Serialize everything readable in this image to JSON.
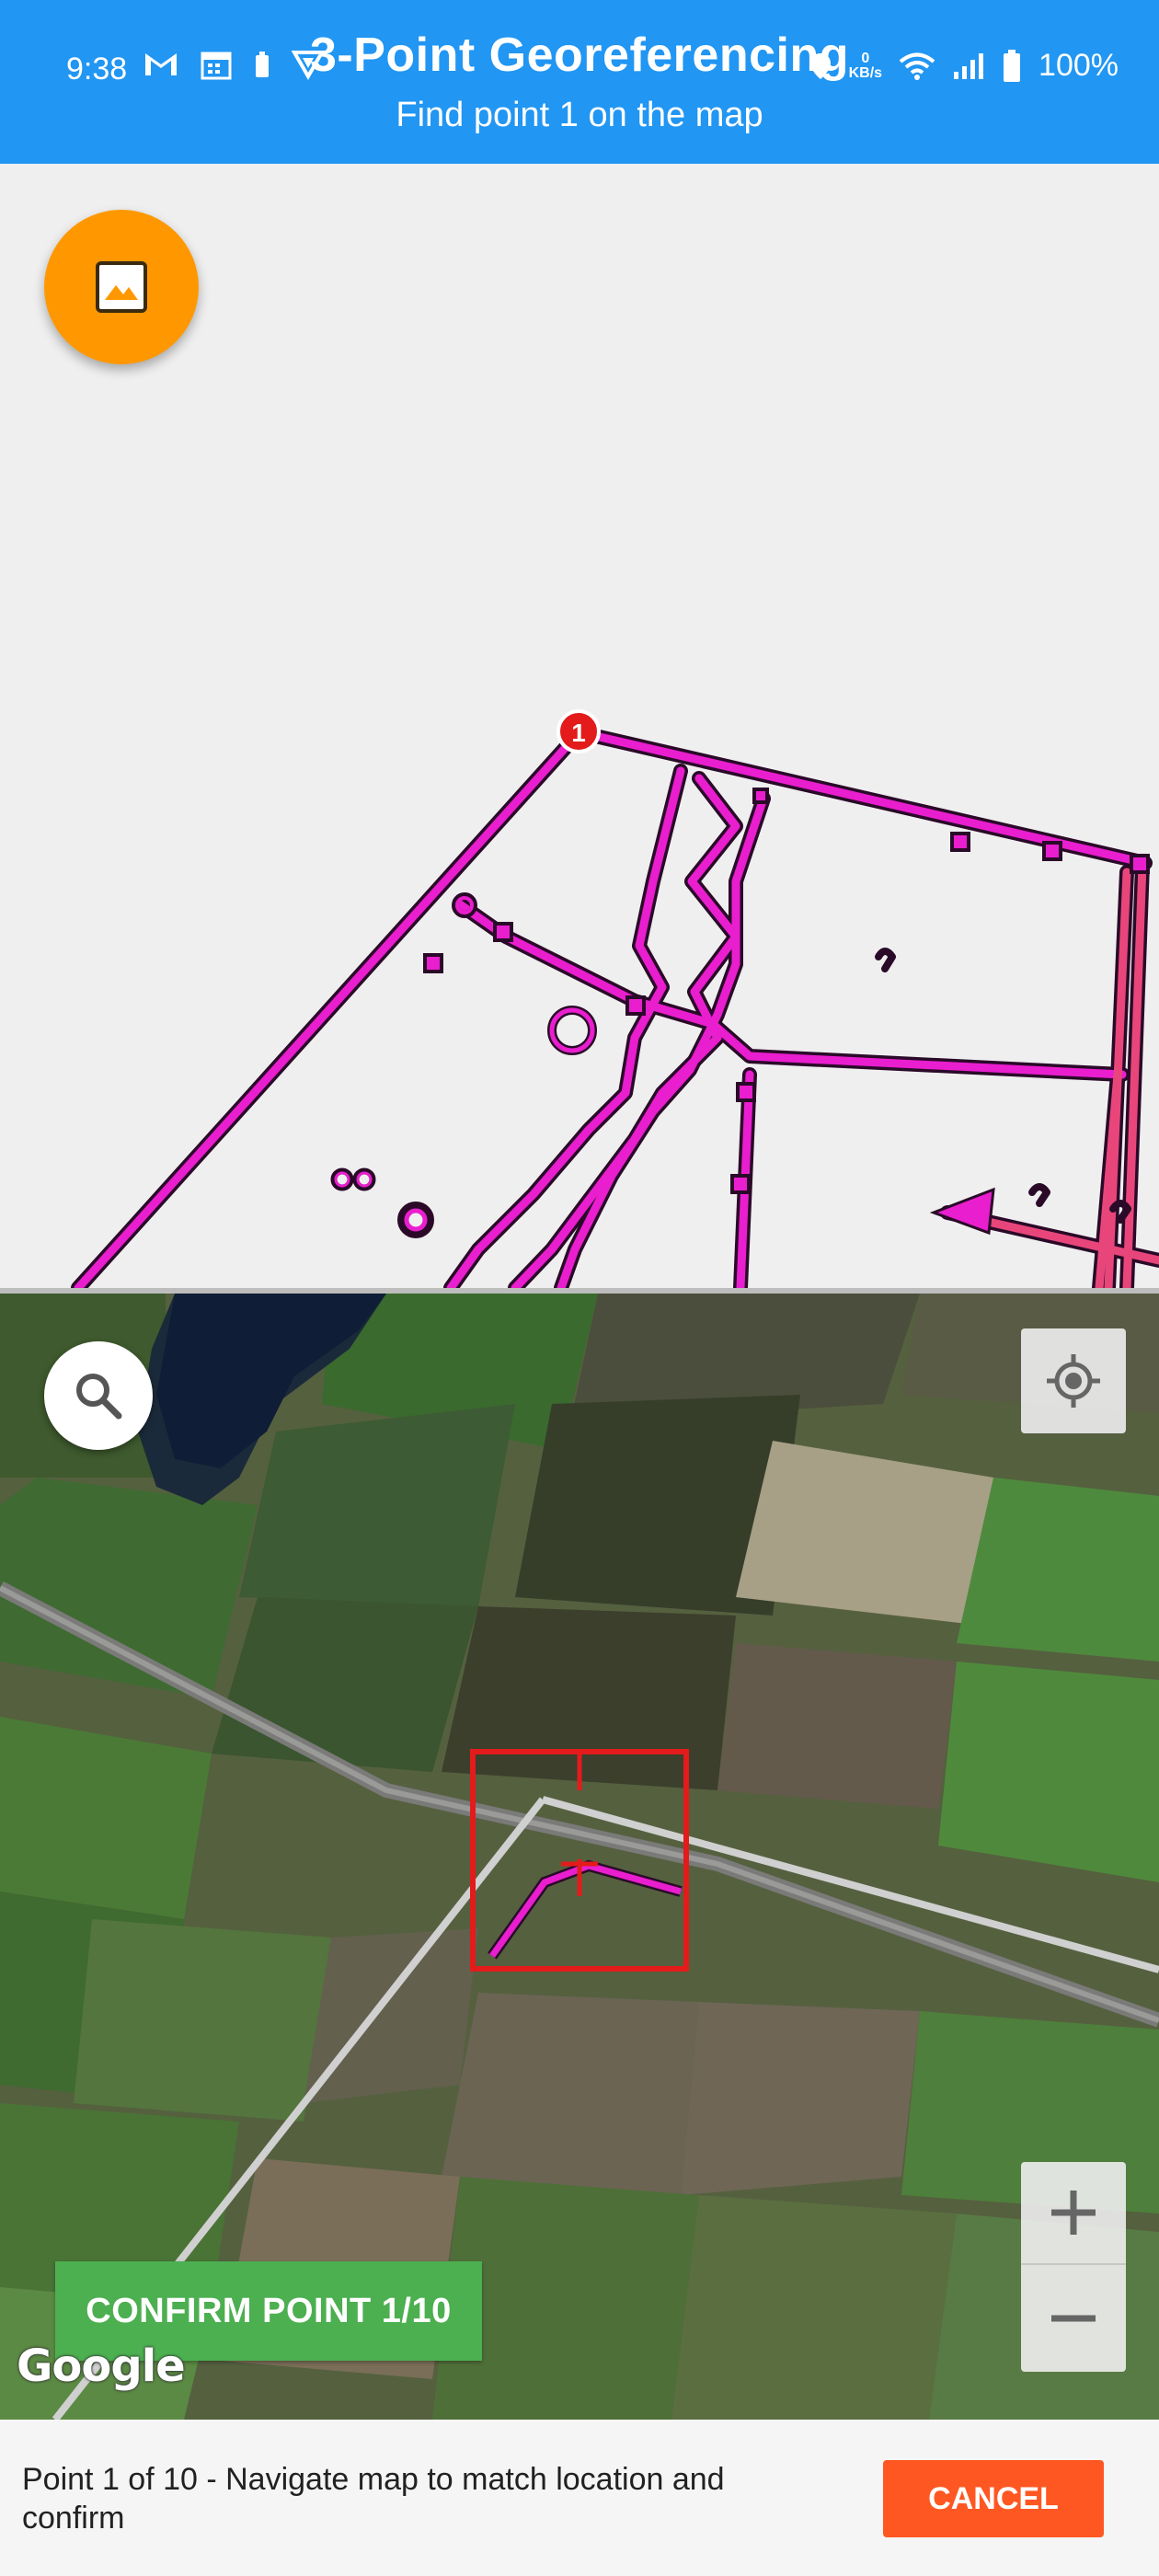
{
  "status_bar": {
    "time": "9:38",
    "battery_percent": "100%",
    "net_speed_value": "0",
    "net_speed_unit": "KB/s"
  },
  "header": {
    "title": "3-Point Georeferencing",
    "subtitle": "Find point 1 on the map"
  },
  "drawing": {
    "marker_label": "1",
    "marker_color": "#E31B1B",
    "line_color": "#E91ECF",
    "fab_color": "#FF9800",
    "fab_icon": "image-icon"
  },
  "map": {
    "attribution": "Google",
    "confirm_label": "CONFIRM POINT 1/10",
    "search_icon": "search-icon",
    "locate_icon": "my-location-icon",
    "zoom_in_icon": "plus-icon",
    "zoom_out_icon": "minus-icon"
  },
  "footer": {
    "message": "Point 1 of 10 - Navigate map to match location and confirm",
    "cancel_label": "CANCEL"
  },
  "colors": {
    "header": "#2196F3",
    "confirm": "#4CAF50",
    "cancel": "#FF5722",
    "target_box": "#E31B1B"
  }
}
